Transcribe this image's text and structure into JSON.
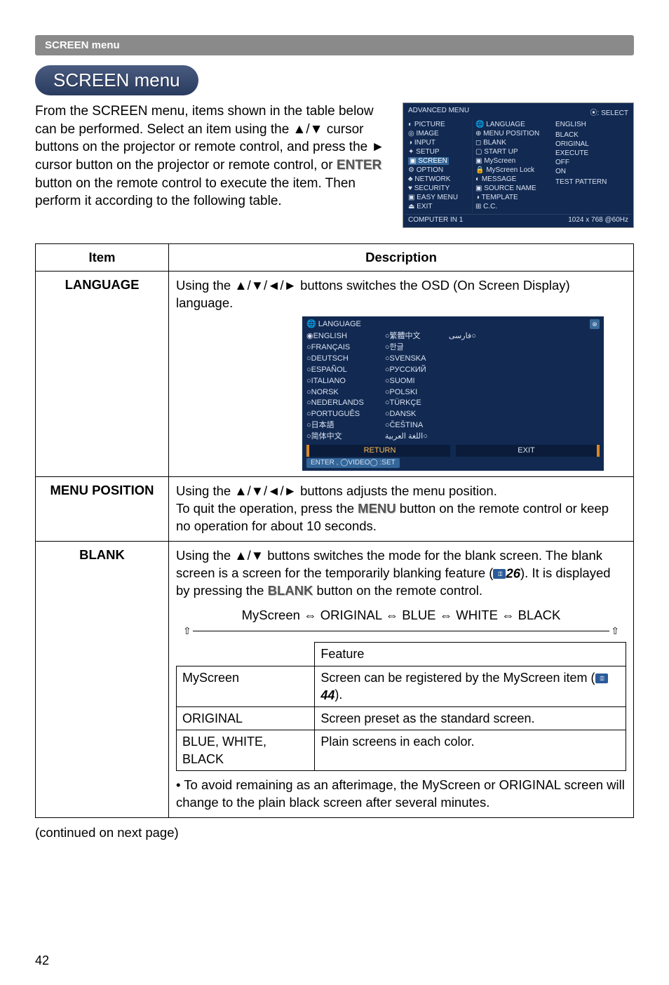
{
  "band": "SCREEN menu",
  "pill": "SCREEN menu",
  "intro": "From the SCREEN menu, items shown in the table below can be performed.\nSelect an item using the ▲/▼ cursor buttons on the projector or remote control, and press the ► cursor button on the projector or remote control, or ",
  "enter_word": "ENTER",
  "intro2": " button on the remote control to execute the item. Then perform it according to the following table.",
  "osd_main": {
    "header_left": "ADVANCED MENU",
    "header_right": "⦿: SELECT",
    "left": [
      "◐ PICTURE",
      "◎ IMAGE",
      "◑ INPUT",
      "✦ SETUP",
      "▣ SCREEN",
      "⚙ OPTION",
      "♣ NETWORK",
      "♥ SECURITY",
      "▣ EASY MENU",
      "⏏ EXIT"
    ],
    "mid": [
      "🌐 LANGUAGE",
      "⊕ MENU POSITION",
      "◻ BLANK",
      "▢ START UP",
      "▣ MyScreen",
      "🔒 MyScreen Lock",
      "◐ MESSAGE",
      "▣ SOURCE NAME",
      "◑ TEMPLATE",
      "⊞ C.C."
    ],
    "right": [
      "ENGLISH",
      "",
      "BLACK",
      "ORIGINAL",
      "EXECUTE",
      "OFF",
      "ON",
      "",
      "TEST PATTERN",
      ""
    ],
    "footer_left": "COMPUTER IN 1",
    "footer_right": "1024 x 768 @60Hz",
    "hl_left_index": 4
  },
  "table_headers": {
    "item": "Item",
    "desc": "Description"
  },
  "row_language": {
    "item": "LANGUAGE",
    "desc_pre": "Using the ▲/▼/◄/► buttons switches the OSD (On Screen Display) language.",
    "osd": {
      "title": "🌐 LANGUAGE",
      "col1": [
        "◉ENGLISH",
        "○FRANÇAIS",
        "○DEUTSCH",
        "○ESPAÑOL",
        "○ITALIANO",
        "○NORSK",
        "○NEDERLANDS",
        "○PORTUGUÊS",
        "○日本語",
        "○简体中文"
      ],
      "col2": [
        "○繁體中文",
        "○한글",
        "○SVENSKA",
        "○РУССКИЙ",
        "○SUOMI",
        "○POLSKI",
        "○TÜRKÇE",
        "○DANSK",
        "○ČEŠTINA",
        "اللغة العربية○"
      ],
      "col3": [
        "فارسی○"
      ],
      "btn_return": "RETURN",
      "btn_exit": "EXIT",
      "footer": "ENTER , ◯VIDEO◯ :SET"
    }
  },
  "row_menu_position": {
    "item": "MENU POSITION",
    "line1": "Using the ▲/▼/◄/► buttons adjusts the menu position.",
    "line2_pre": "To quit the operation, press the ",
    "menu_word": "MENU",
    "line2_post": " button on the remote control or keep no operation for about 10 seconds."
  },
  "row_blank": {
    "item": "BLANK",
    "p1": "Using the ▲/▼ buttons switches the mode for the blank screen. The blank screen is a screen for the temporarily blanking feature (",
    "ref1": "26",
    "p1_post": "). It is displayed by pressing the ",
    "blank_word": "BLANK",
    "p1_end": " button on the remote control.",
    "seq": "MyScreen ⇔ ORIGINAL ⇔ BLUE ⇔ WHITE ⇔ BLACK",
    "feature_head": "Feature",
    "rows": [
      {
        "k": "MyScreen",
        "v_pre": "Screen can be registered by the MyScreen item (",
        "ref": "44",
        "v_post": ")."
      },
      {
        "k": "ORIGINAL",
        "v": "Screen preset as the standard screen."
      },
      {
        "k": "BLUE, WHITE, BLACK",
        "v": "Plain screens in each color."
      }
    ],
    "note": "• To avoid remaining as an afterimage, the MyScreen or ORIGINAL screen will change to the plain black screen after several minutes."
  },
  "continued": "(continued on next page)",
  "page_number": "42"
}
